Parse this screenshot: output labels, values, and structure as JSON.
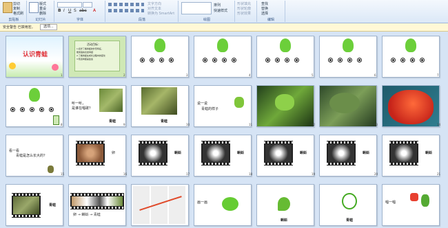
{
  "ribbon": {
    "groups": [
      {
        "label": "剪贴板",
        "items": [
          "粘贴",
          "剪切",
          "复制",
          "格式刷"
        ]
      },
      {
        "label": "幻灯片",
        "items": [
          "新建幻灯片",
          "版式",
          "重设",
          "删除"
        ]
      },
      {
        "label": "字体",
        "items": [
          "B",
          "I",
          "U",
          "S",
          "abc",
          "A"
        ]
      },
      {
        "label": "段落",
        "items": [
          "文字方向",
          "对齐文本",
          "转换为 SmartArt"
        ]
      },
      {
        "label": "绘图",
        "items": [
          "形状",
          "排列",
          "快速样式"
        ]
      },
      {
        "label": "编辑",
        "items": [
          "查找",
          "替换",
          "选择"
        ]
      }
    ],
    "right_items": [
      "形状填充",
      "形状轮廓",
      "形状效果"
    ]
  },
  "security": {
    "warning": "安全警告  已禁用宏。",
    "options_label": "选项..."
  },
  "slides": [
    {
      "n": "1",
      "title": "认识青蛙"
    },
    {
      "n": "2",
      "lines": [
        "活动目标：",
        "1.初步了解青蛙的外形特征，",
        "能用语言表述青蛙",
        "2.了解青蛙在成长过程中的变化",
        "3.知道青蛙是益虫"
      ]
    },
    {
      "n": "3"
    },
    {
      "n": "4"
    },
    {
      "n": "5"
    },
    {
      "n": "6"
    },
    {
      "n": "7"
    },
    {
      "n": "8"
    },
    {
      "n": "9",
      "lines": [
        "听一听，",
        "是谁在唱歌？"
      ],
      "caption": "青蛙"
    },
    {
      "n": "10",
      "caption": "青蛙"
    },
    {
      "n": "11",
      "lines": [
        "说一说",
        "青蛙的样子"
      ]
    },
    {
      "n": "12"
    },
    {
      "n": "13"
    },
    {
      "n": "14"
    },
    {
      "n": "15",
      "lines": [
        "看一看",
        "青蛙是怎么长大的？"
      ]
    },
    {
      "n": "16",
      "caption": "卵"
    },
    {
      "n": "17",
      "caption": "蝌蚪"
    },
    {
      "n": "18",
      "caption": "蝌蚪"
    },
    {
      "n": "19",
      "caption": "蝌蚪"
    },
    {
      "n": "20",
      "caption": "蝌蚪"
    },
    {
      "n": "21",
      "caption": "蝌蚪"
    },
    {
      "n": "22",
      "caption": "青蛙"
    },
    {
      "n": "23",
      "sequence": "卵 → 蝌蚪 → 青蛙"
    },
    {
      "n": "24"
    },
    {
      "n": "25",
      "lines": [
        "画一画"
      ]
    },
    {
      "n": "26",
      "caption": "蝌蚪"
    },
    {
      "n": "27",
      "caption": "青蛙"
    },
    {
      "n": "28",
      "lines": [
        "唱一唱"
      ]
    }
  ]
}
